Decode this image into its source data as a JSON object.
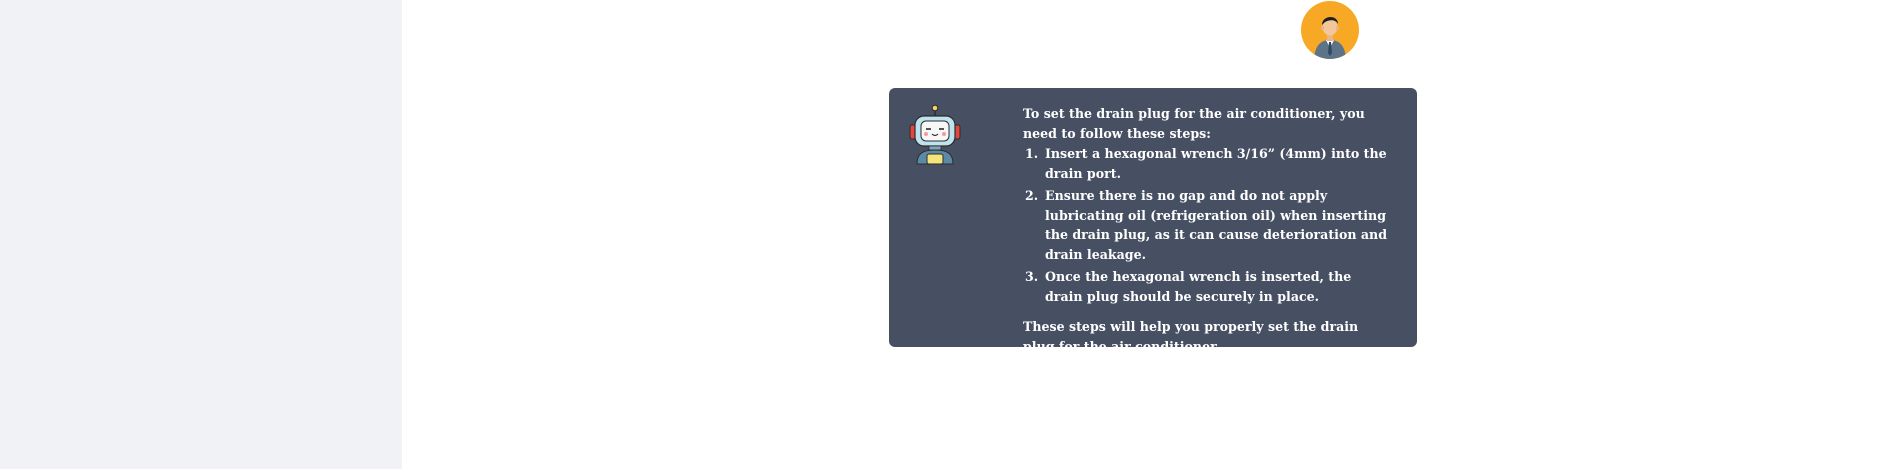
{
  "chat": {
    "bot_message": {
      "intro": "To set the drain plug for the air conditioner, you need to follow these steps:",
      "steps": [
        {
          "num": "1.",
          "text": "Insert a hexagonal wrench 3/16” (4mm) into the drain port."
        },
        {
          "num": "2.",
          "text": "Ensure there is no gap and do not apply lubricating oil (refrigeration oil) when inserting the drain plug, as it can cause deterioration and drain leakage."
        },
        {
          "num": "3.",
          "text": "Once the hexagonal wrench is inserted, the drain plug should be securely in place."
        }
      ],
      "outro": "These steps will help you properly set the drain plug for the air conditioner."
    },
    "icons": {
      "user_avatar": "user-avatar-icon",
      "bot_avatar": "robot-avatar-icon"
    }
  },
  "colors": {
    "sidebar_bg": "#f1f2f5",
    "bubble_bg": "#475063",
    "user_avatar_bg": "#f7a824",
    "text": "#ffffff"
  }
}
